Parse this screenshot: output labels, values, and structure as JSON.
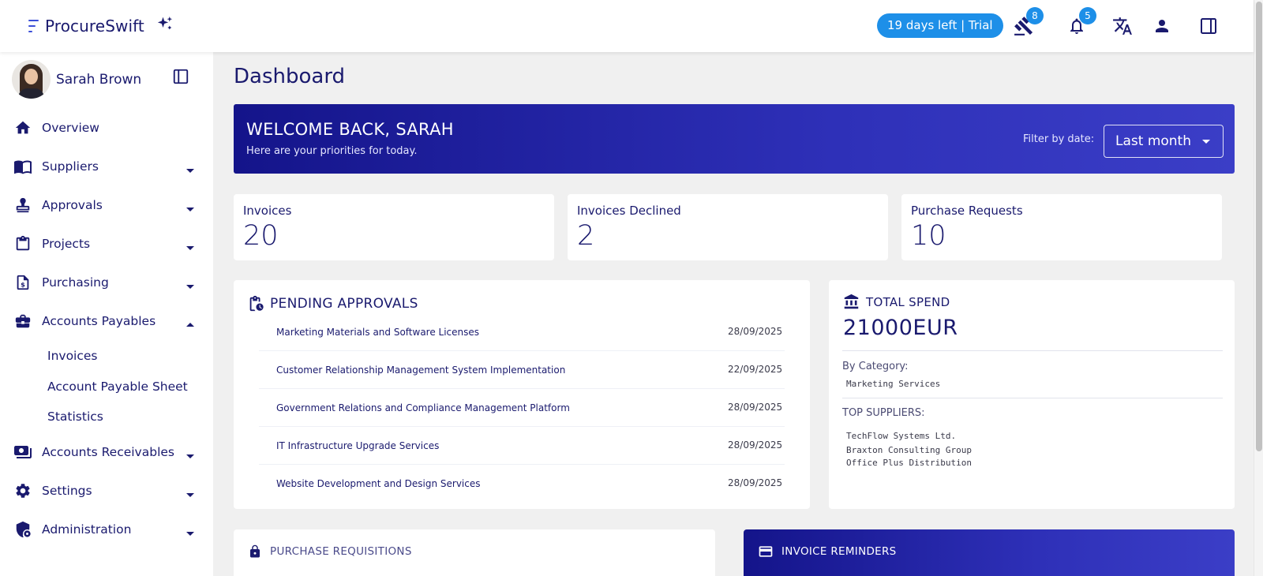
{
  "app": {
    "name": "ProcureSwift",
    "trial_text": "19 days left | Trial",
    "gavel_badge": "8",
    "bell_badge": "5"
  },
  "user": {
    "name": "Sarah Brown"
  },
  "sidebar": {
    "items": [
      {
        "label": "Overview",
        "icon": "home-icon"
      },
      {
        "label": "Suppliers",
        "icon": "book-icon"
      },
      {
        "label": "Approvals",
        "icon": "stamp-icon"
      },
      {
        "label": "Projects",
        "icon": "clipboard-icon"
      },
      {
        "label": "Purchasing",
        "icon": "dollar-document-icon"
      },
      {
        "label": "Accounts Payables",
        "icon": "briefcase-icon"
      },
      {
        "label": "Accounts Receivables",
        "icon": "money-icon"
      },
      {
        "label": "Settings",
        "icon": "gear-icon"
      },
      {
        "label": "Administration",
        "icon": "shield-icon"
      }
    ],
    "sub_items": [
      "Invoices",
      "Account Payable Sheet",
      "Statistics"
    ]
  },
  "dashboard": {
    "title": "Dashboard",
    "welcome_title": "WELCOME BACK, SARAH",
    "welcome_subtitle": "Here are your priorities for today.",
    "filter_label": "Filter by date:",
    "filter_value": "Last month",
    "stats": [
      {
        "label": "Invoices",
        "value": "20"
      },
      {
        "label": "Invoices Declined",
        "value": "2"
      },
      {
        "label": "Purchase Requests",
        "value": "10"
      }
    ],
    "pending": {
      "title": "PENDING APPROVALS",
      "rows": [
        {
          "name": "Marketing Materials and Software Licenses",
          "date": "28/09/2025"
        },
        {
          "name": "Customer Relationship Management System Implementation",
          "date": "22/09/2025"
        },
        {
          "name": "Government Relations and Compliance Management Platform",
          "date": "28/09/2025"
        },
        {
          "name": "IT Infrastructure Upgrade Services",
          "date": "28/09/2025"
        },
        {
          "name": "Website Development and Design Services",
          "date": "28/09/2025"
        }
      ]
    },
    "total_spend": {
      "title": "TOTAL SPEND",
      "amount": "21000EUR",
      "by_category_label": "By Category:",
      "category": "Marketing Services",
      "top_suppliers_label": "TOP SUPPLIERS:",
      "suppliers": [
        "TechFlow Systems Ltd.",
        "Braxton Consulting Group",
        "Office Plus Distribution"
      ]
    },
    "requisitions_title": "PURCHASE REQUISITIONS",
    "reminders_title": "INVOICE REMINDERS"
  },
  "colors": {
    "brand_navy": "#1a1a6e",
    "accent_blue": "#1d8fe8",
    "banner_start": "#14148a",
    "banner_end": "#3b3ec7"
  }
}
